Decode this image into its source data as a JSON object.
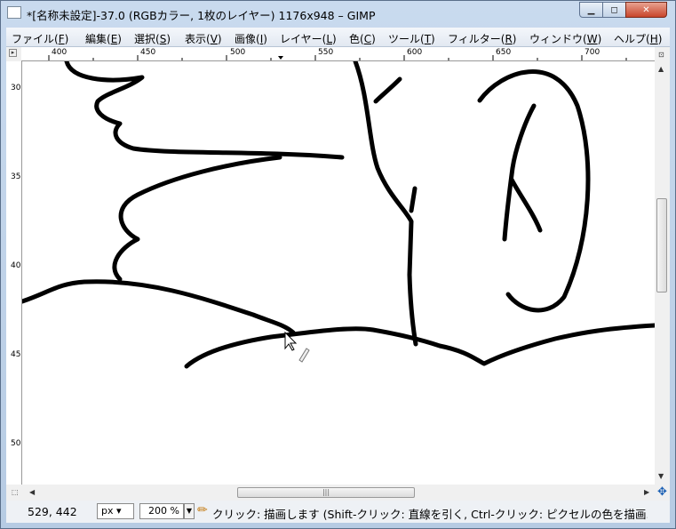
{
  "window": {
    "title": "*[名称未設定]-37.0 (RGBカラー, 1枚のレイヤー) 1176x948 – GIMP",
    "min_symbol": "▁",
    "max_symbol": "◻",
    "close_symbol": "✕"
  },
  "menus": [
    {
      "label": "ファイル(",
      "acc": "F",
      "end": ")"
    },
    {
      "label": "編集(",
      "acc": "E",
      "end": ")"
    },
    {
      "label": "選択(",
      "acc": "S",
      "end": ")"
    },
    {
      "label": "表示(",
      "acc": "V",
      "end": ")"
    },
    {
      "label": "画像(",
      "acc": "I",
      "end": ")"
    },
    {
      "label": "レイヤー(",
      "acc": "L",
      "end": ")"
    },
    {
      "label": "色(",
      "acc": "C",
      "end": ")"
    },
    {
      "label": "ツール(",
      "acc": "T",
      "end": ")"
    },
    {
      "label": "フィルター(",
      "acc": "R",
      "end": ")"
    },
    {
      "label": "ウィンドウ(",
      "acc": "W",
      "end": ")"
    },
    {
      "label": "ヘルプ(",
      "acc": "H",
      "end": ")"
    }
  ],
  "hruler": [
    "400",
    "450",
    "500",
    "550",
    "600",
    "650",
    "700"
  ],
  "vruler": [
    "300",
    "350",
    "400",
    "450",
    "500"
  ],
  "status": {
    "coords": "529, 442",
    "unit": "px",
    "zoom": "200 %",
    "message": "クリック: 描画します (Shift-クリック: 直線を引く, Ctrl-クリック: ピクセルの色を描画..."
  },
  "icons": {
    "corner": "menu-arrow-icon",
    "pencil": "pencil-icon",
    "navigate": "navigate-icon"
  }
}
